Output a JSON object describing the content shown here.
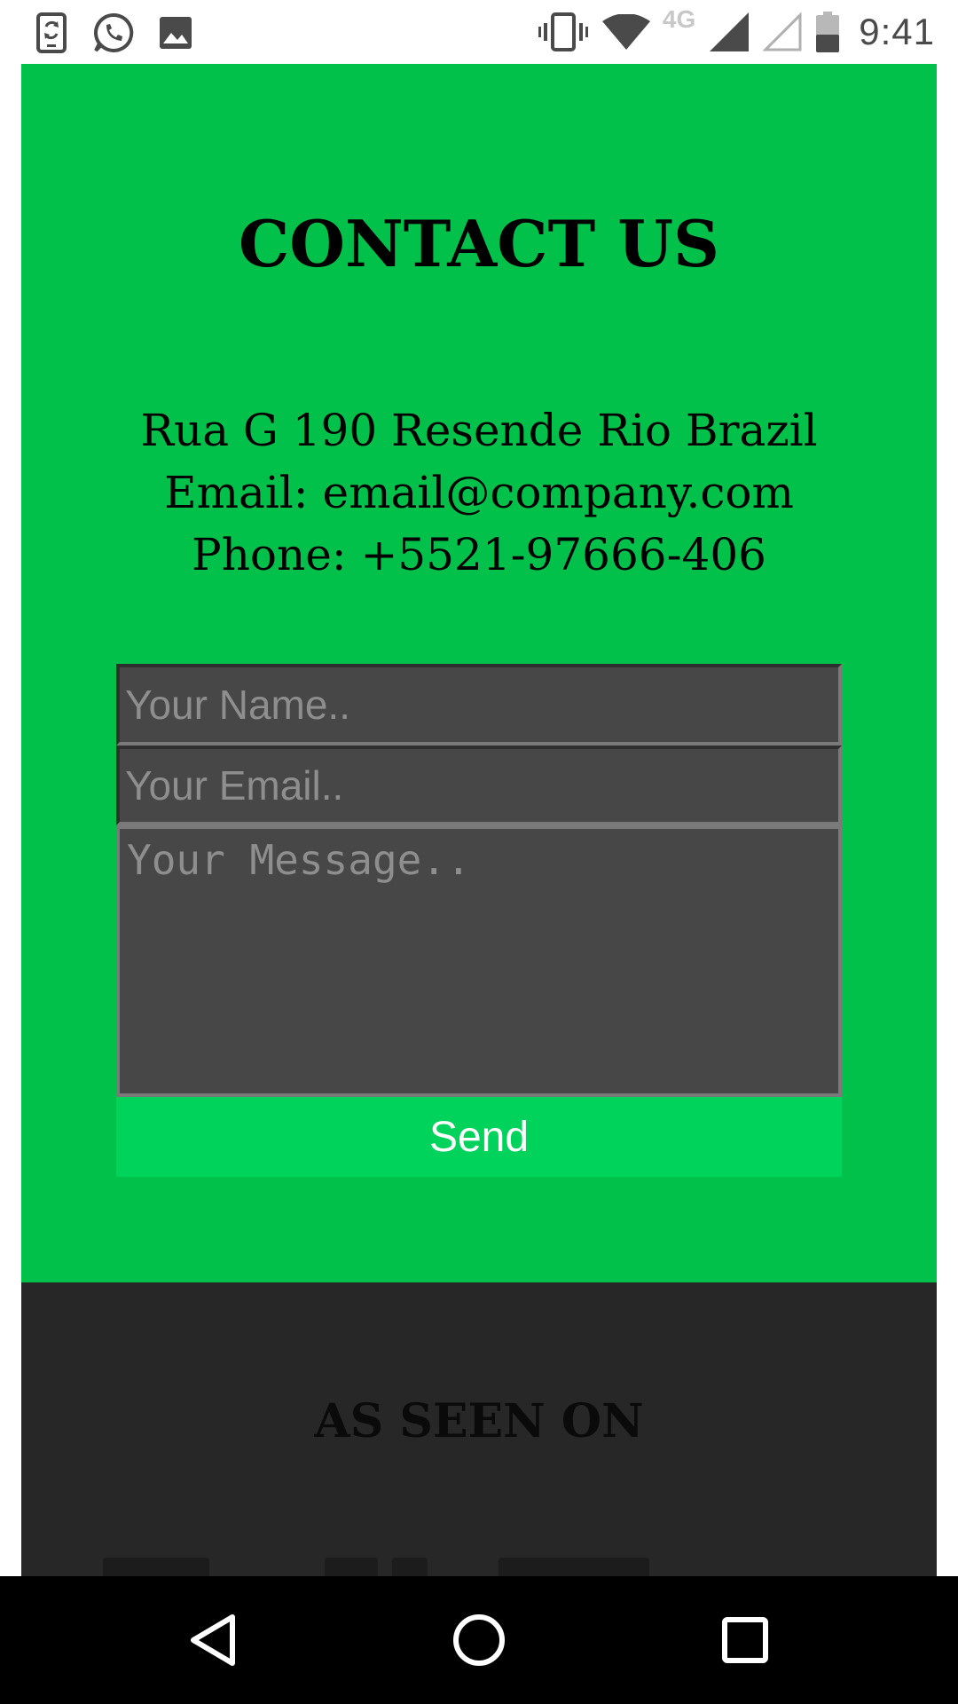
{
  "statusbar": {
    "icons_left": [
      "sync-phone-icon",
      "whatsapp-icon",
      "image-icon"
    ],
    "icons_right": [
      "vibrate-icon",
      "wifi-icon",
      "cell-signal-icon",
      "cell-signal-empty-icon",
      "battery-icon"
    ],
    "network_type": "4G",
    "time": "9:41"
  },
  "contact": {
    "title": "CONTACT US",
    "address": "Rua G 190 Resende Rio Brazil",
    "email": "Email: email@company.com",
    "phone": "Phone: +5521-97666-406",
    "bg_color": "#02c14b"
  },
  "form": {
    "name_placeholder": "Your Name..",
    "email_placeholder": "Your Email..",
    "message_placeholder": "Your Message..",
    "send_label": "Send",
    "send_color": "#00d35c",
    "field_color": "#474747"
  },
  "seen_on": {
    "title": "AS SEEN ON",
    "bg_color": "#272727"
  },
  "navbar": {
    "buttons": [
      "back-icon",
      "home-icon",
      "recents-icon"
    ]
  }
}
